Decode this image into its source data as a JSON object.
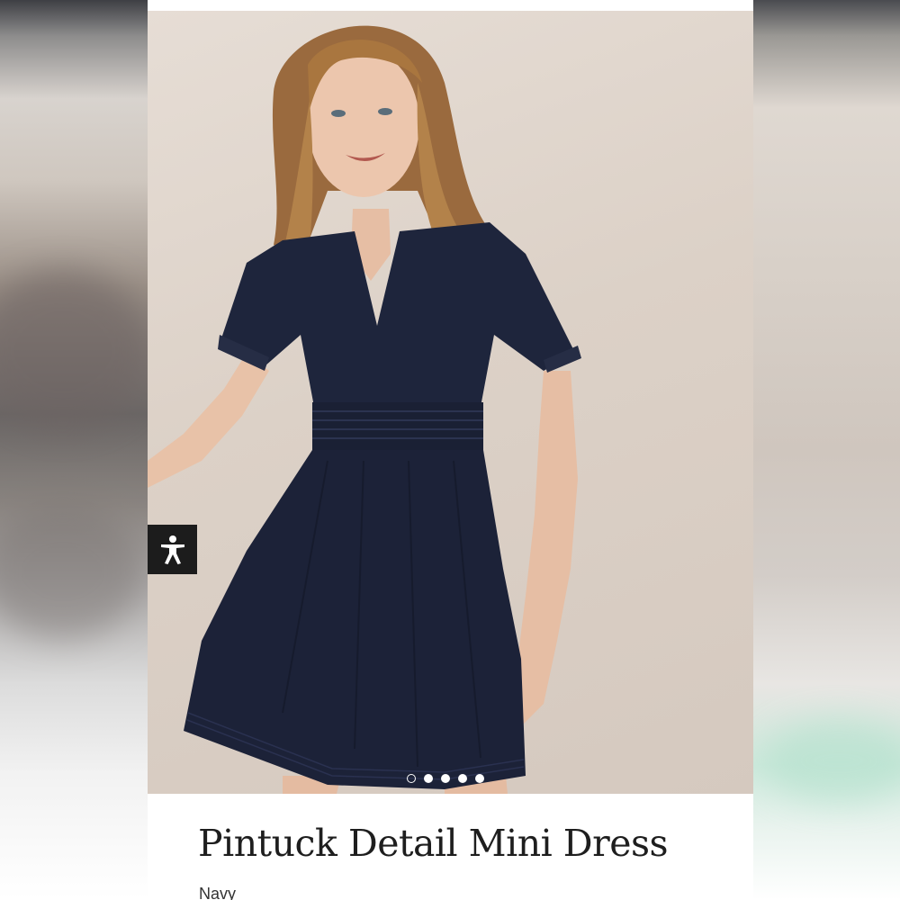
{
  "product": {
    "title": "Pintuck Detail Mini Dress",
    "color": "Navy"
  },
  "gallery": {
    "image_count": 5,
    "active_index": 0,
    "image_alt": "Model wearing a navy short-sleeve mini dress with smocked waist"
  },
  "accessibility_button": {
    "icon": "accessibility-person-icon"
  },
  "colors": {
    "dress": "#1c2238",
    "background": "#dcd1c7",
    "accessibility_button": "#1c1c1c",
    "title_text": "#1e1e1e"
  }
}
